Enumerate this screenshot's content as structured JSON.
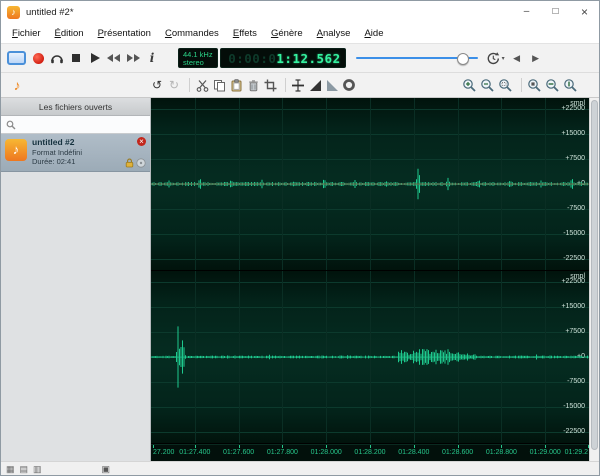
{
  "window": {
    "title": "untitled #2*",
    "controls": {
      "minimize": "–",
      "maximize": "□",
      "close": "×"
    }
  },
  "menubar": {
    "items": [
      "Fichier",
      "Édition",
      "Présentation",
      "Commandes",
      "Effets",
      "Génère",
      "Analyse",
      "Aide"
    ]
  },
  "transport": {
    "lcd": {
      "samplerate": "44.1 kHz",
      "channels": "stereo"
    },
    "time": {
      "dim": "0:00:0",
      "bright": "1:12.562"
    }
  },
  "sidebar": {
    "header": "Les fichiers ouverts",
    "search_placeholder": "",
    "file": {
      "title": "untitled #2",
      "format": "Format Indéfini",
      "duration": "Durée: 02:41"
    }
  },
  "waveform": {
    "scale_labels": [
      "smpl",
      "+22500",
      "+15000",
      "+7500",
      "+0",
      "-7500",
      "-15000",
      "-22500"
    ],
    "timeline": [
      "27.200",
      "01:27.400",
      "01:27.600",
      "01:27.800",
      "01:28.000",
      "01:28.200",
      "01:28.400",
      "01:28.600",
      "01:28.800",
      "01:29.000",
      "01:29.2"
    ]
  },
  "icons": {
    "note": "♪",
    "info": "i",
    "undo": "↺",
    "redo": "↻",
    "left_arrow": "◀",
    "right_arrow": "▶",
    "caret": "▾",
    "grid1": "▦",
    "grid2": "▤",
    "grid3": "▥",
    "panel": "▣",
    "close": "×"
  },
  "colors": {
    "lcd_green": "#2bd488",
    "time_green": "#35f2a0",
    "wave_green": "#1ec98e",
    "accent_blue": "#3b8fe8",
    "record_red": "#d21f12",
    "file_icon_orange": "#ee8822",
    "panel_bg": "#02231a"
  }
}
